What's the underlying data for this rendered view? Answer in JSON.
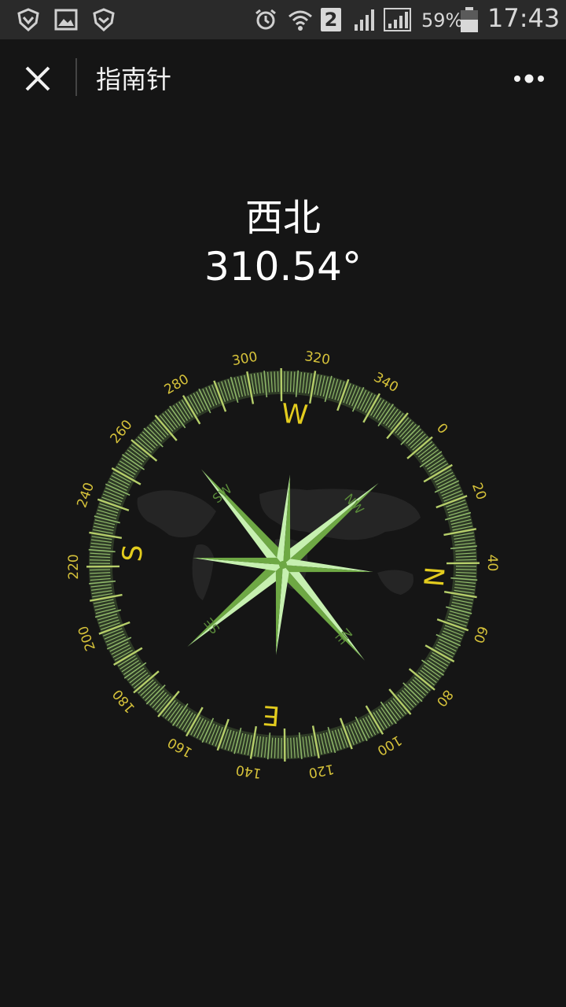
{
  "status_bar": {
    "sim_badge": "2",
    "battery": "59%",
    "time": "17:43",
    "icons": [
      "shield-icon",
      "gallery-icon",
      "shield-check-icon",
      "alarm-icon",
      "wifi-icon",
      "signal-icon",
      "signal-icon",
      "battery-icon"
    ]
  },
  "titlebar": {
    "title": "指南针",
    "close_icon": "close-icon",
    "more_icon": "more-dots-icon"
  },
  "heading": {
    "direction": "西北",
    "degree": "310.54°"
  },
  "compass": {
    "heading_deg": 310.54,
    "cardinals": [
      "N",
      "E",
      "S",
      "W"
    ],
    "intercardinals": [
      "NE",
      "SE",
      "SW",
      "NW"
    ],
    "dial_labels": [
      "0",
      "20",
      "40",
      "60",
      "80",
      "100",
      "120",
      "140",
      "160",
      "180",
      "200",
      "220",
      "240",
      "260",
      "280",
      "300",
      "320",
      "340"
    ],
    "colors": {
      "dial": "#8fb86a",
      "label": "#d6c23a",
      "cardinal": "#e3cc1e",
      "star_light": "#c6f0b0",
      "star_dark": "#6ea844",
      "intercardinal": "#5a8a3a"
    }
  }
}
